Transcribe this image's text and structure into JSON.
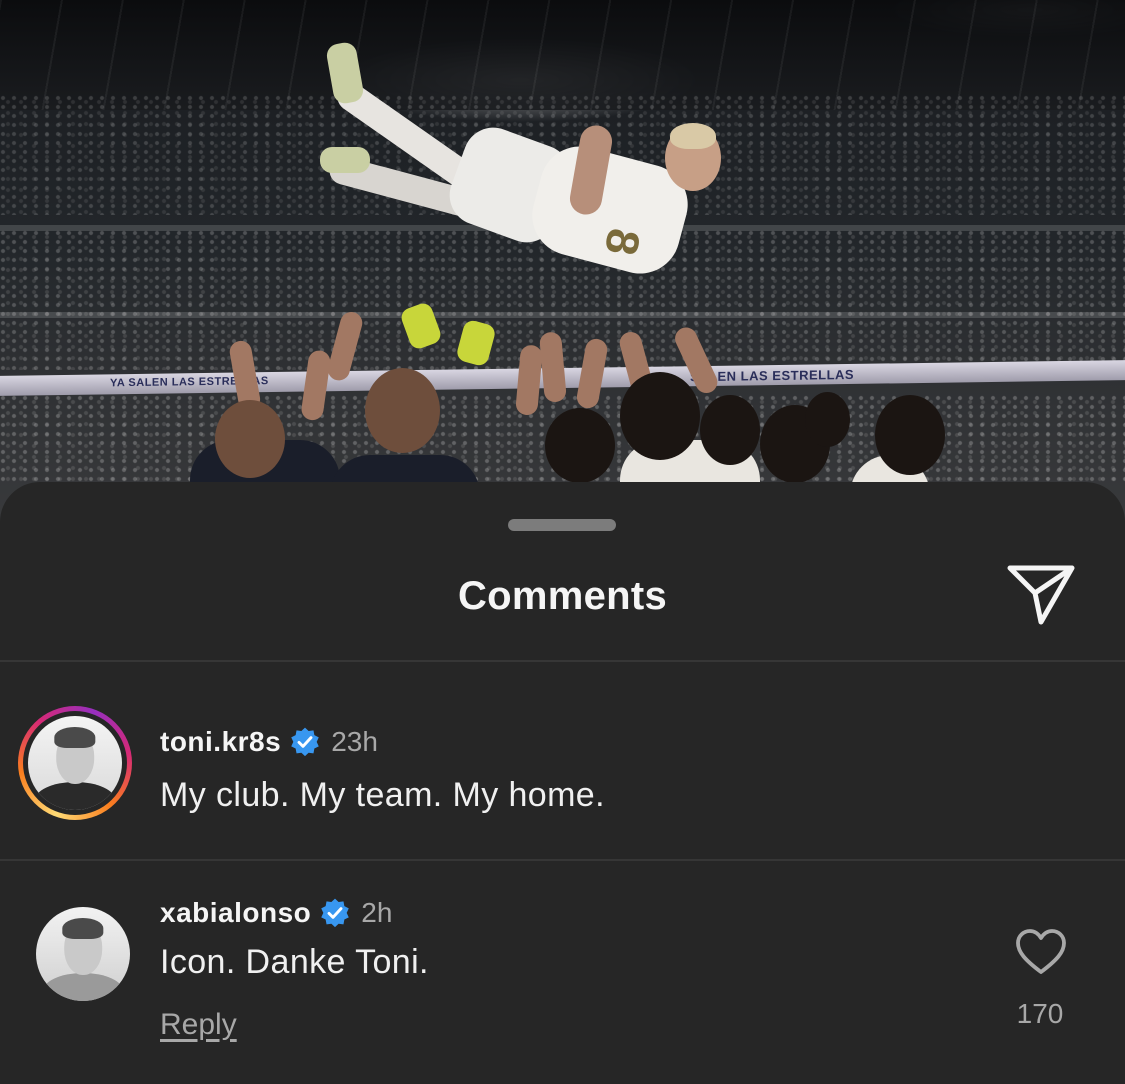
{
  "photo": {
    "banner_left": "YA SALEN LAS ESTRELLAS",
    "banner_right": "SALEN LAS ESTRELLAS",
    "jersey_number": "8"
  },
  "sheet": {
    "title": "Comments",
    "share_icon": "paper-plane-icon"
  },
  "comments": [
    {
      "username": "toni.kr8s",
      "verified": true,
      "time": "23h",
      "text": "My club. My team. My home.",
      "has_story_ring": true
    },
    {
      "username": "xabialonso",
      "verified": true,
      "time": "2h",
      "text": "Icon. Danke Toni.",
      "reply_label": "Reply",
      "like_icon": "heart-outline-icon",
      "like_count": "170"
    }
  ],
  "colors": {
    "sheet_bg": "#262626",
    "verified_blue": "#3897f0",
    "muted_text": "#a8a8a8"
  }
}
